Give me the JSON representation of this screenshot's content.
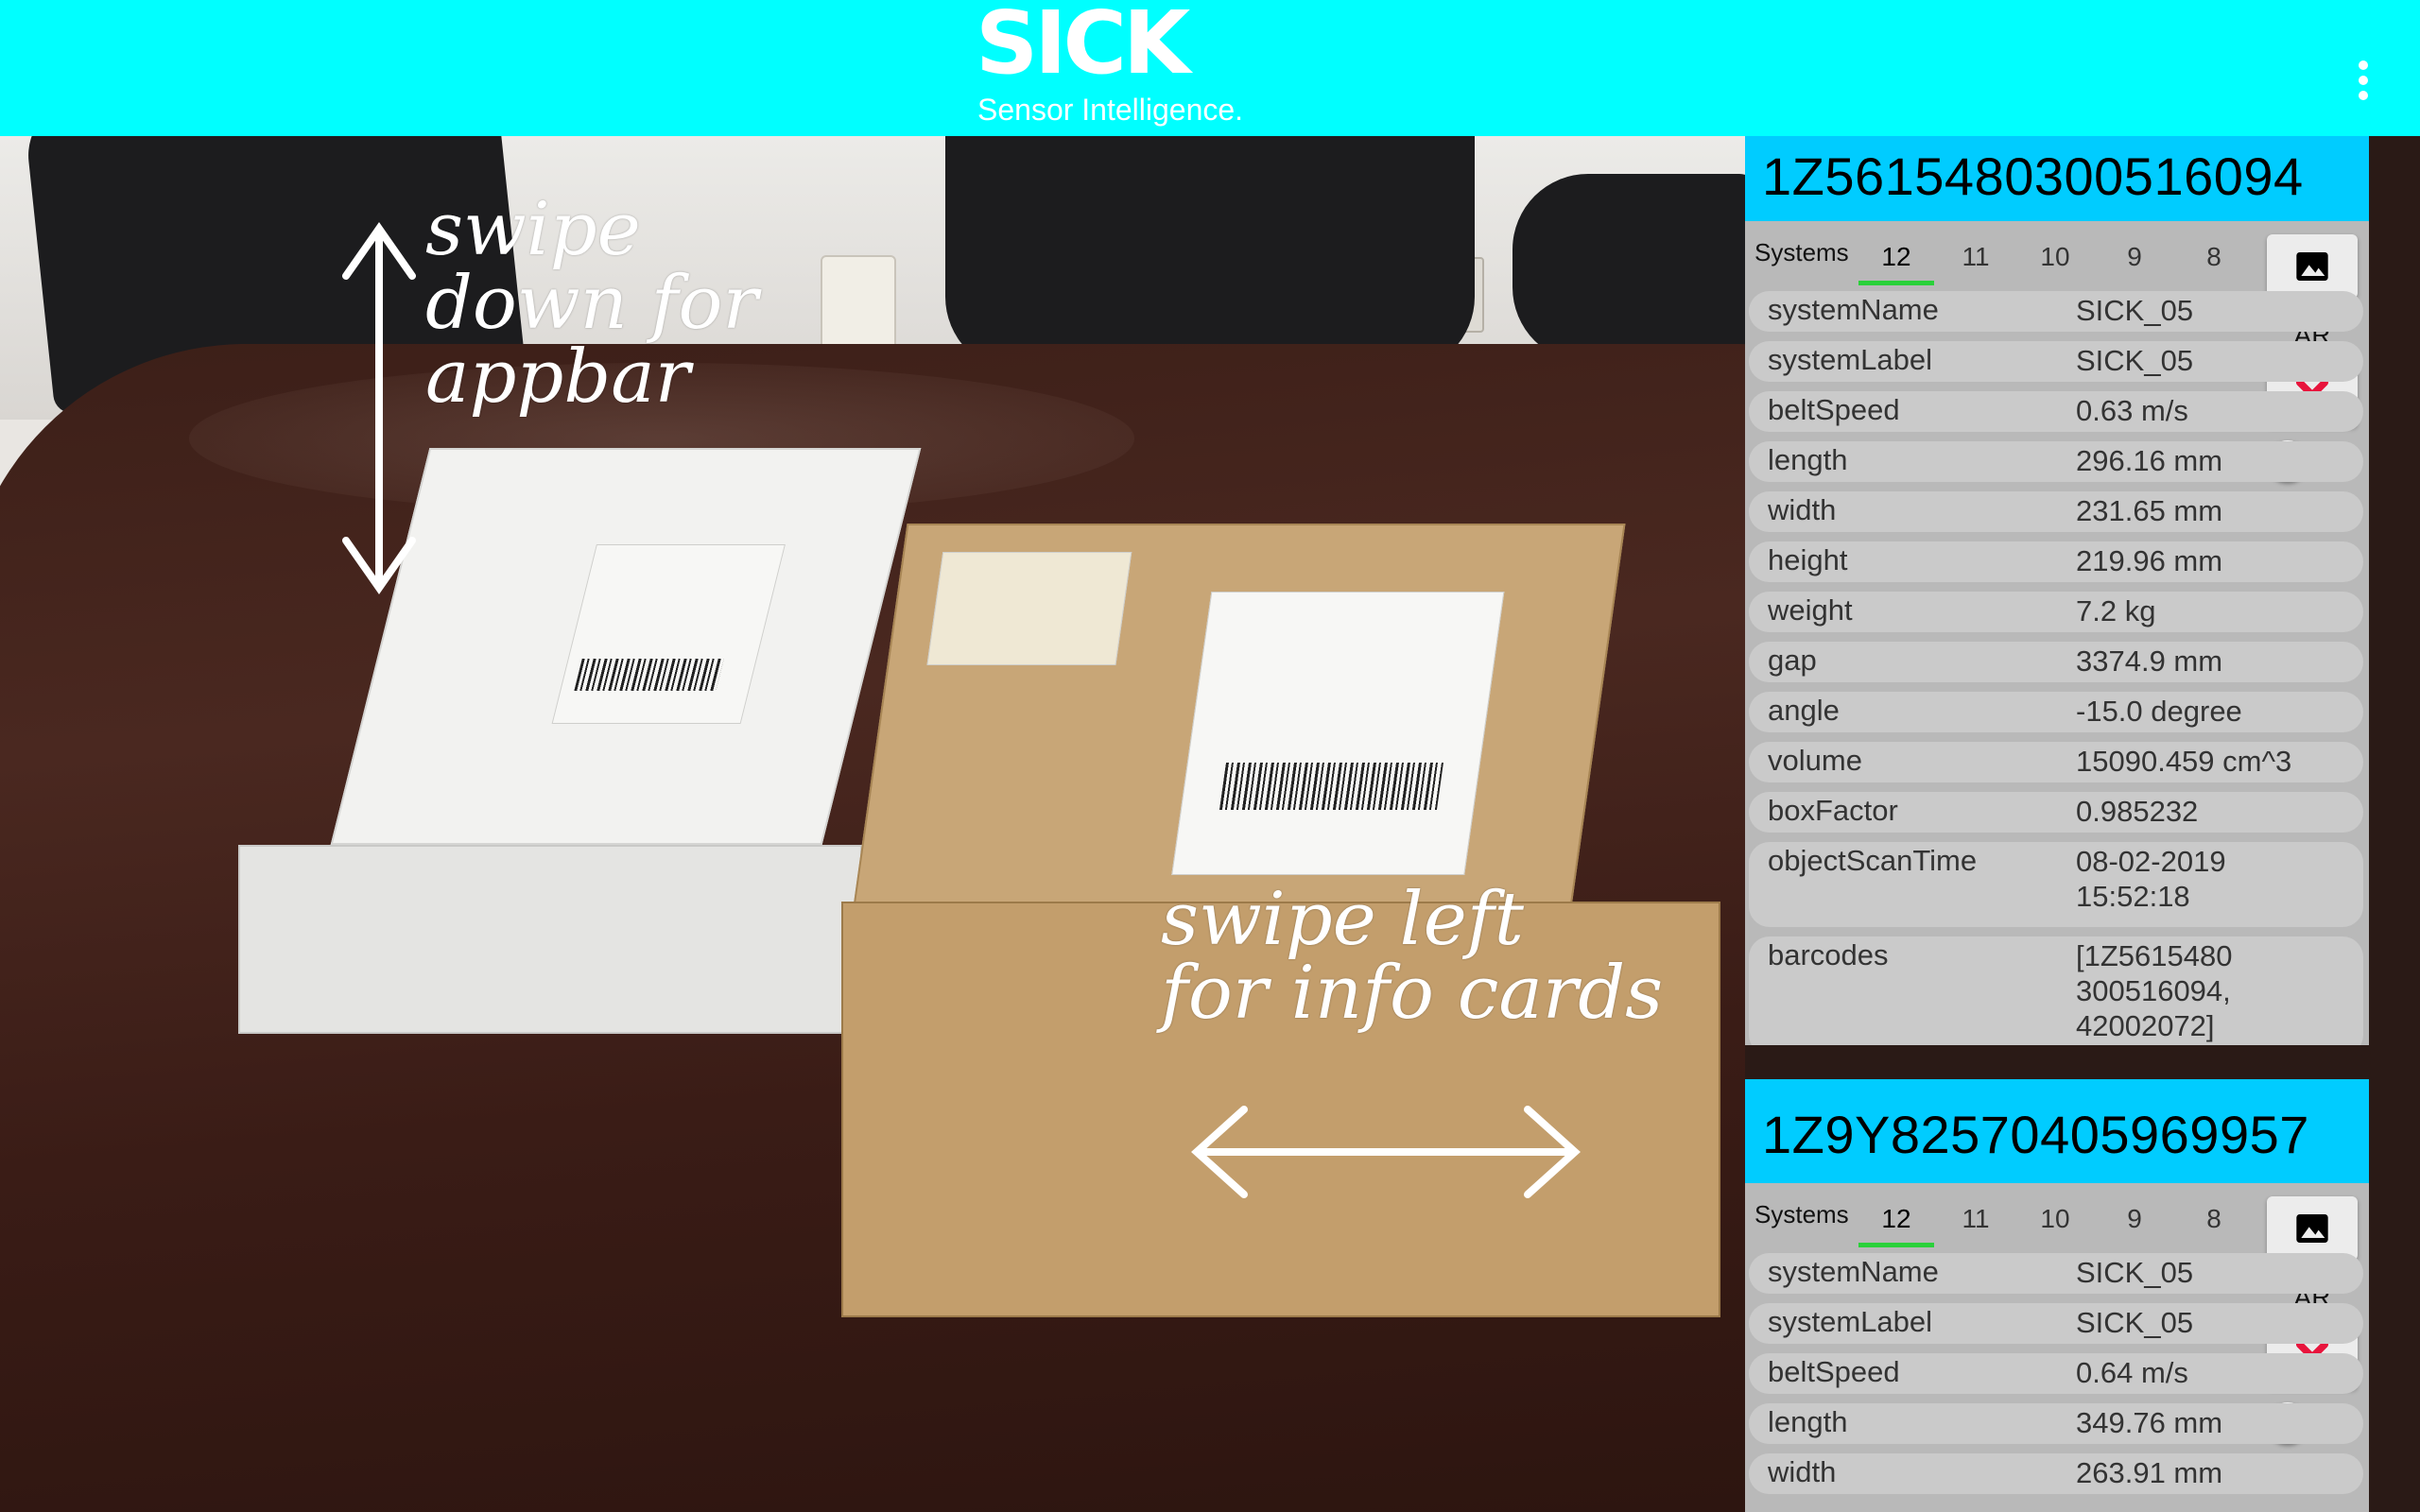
{
  "appbar": {
    "logo_word": "SICK",
    "logo_tagline": "Sensor Intelligence.",
    "menu_icon": "more-vert-icon",
    "background": "#00ffff"
  },
  "overlay_hints": {
    "hint_top": [
      "swipe",
      "down for",
      "appbar"
    ],
    "hint_middle": [
      "swipe left",
      "for info cards"
    ]
  },
  "cards": [
    {
      "id": "1Z5615480300516094",
      "systems_label": "Systems",
      "system_tabs": [
        "12",
        "11",
        "10",
        "9",
        "8"
      ],
      "active_tab": "12",
      "image_button_icon": "image-icon",
      "ar_label": "AR",
      "close_icon": "close-icon",
      "ar_toggle_on": false,
      "fields": [
        {
          "key": "systemName",
          "value": "SICK_05"
        },
        {
          "key": "systemLabel",
          "value": "SICK_05"
        },
        {
          "key": "beltSpeed",
          "value": "0.63 m/s"
        },
        {
          "key": "length",
          "value": "296.16 mm"
        },
        {
          "key": "width",
          "value": "231.65 mm"
        },
        {
          "key": "height",
          "value": "219.96 mm"
        },
        {
          "key": "weight",
          "value": "7.2 kg"
        },
        {
          "key": "gap",
          "value": "3374.9 mm"
        },
        {
          "key": "angle",
          "value": "-15.0 degree"
        },
        {
          "key": "volume",
          "value": "15090.459 cm^3"
        },
        {
          "key": "boxFactor",
          "value": "0.985232"
        },
        {
          "key": "objectScanTime",
          "value": "08-02-2019\n15:52:18"
        },
        {
          "key": "barcodes",
          "value": "[1Z5615480\n300516094,\n42002072]"
        }
      ]
    },
    {
      "id": "1Z9Y82570405969957",
      "systems_label": "Systems",
      "system_tabs": [
        "12",
        "11",
        "10",
        "9",
        "8"
      ],
      "active_tab": "12",
      "image_button_icon": "image-icon",
      "ar_label": "AR",
      "close_icon": "close-icon",
      "ar_toggle_on": false,
      "fields": [
        {
          "key": "systemName",
          "value": "SICK_05"
        },
        {
          "key": "systemLabel",
          "value": "SICK_05"
        },
        {
          "key": "beltSpeed",
          "value": "0.64 m/s"
        },
        {
          "key": "length",
          "value": "349.76 mm"
        },
        {
          "key": "width",
          "value": "263.91 mm"
        }
      ]
    }
  ],
  "colors": {
    "card_header": "#00ccff",
    "active_tab_underline": "#2ad13a",
    "close_x": "#e8143c"
  }
}
